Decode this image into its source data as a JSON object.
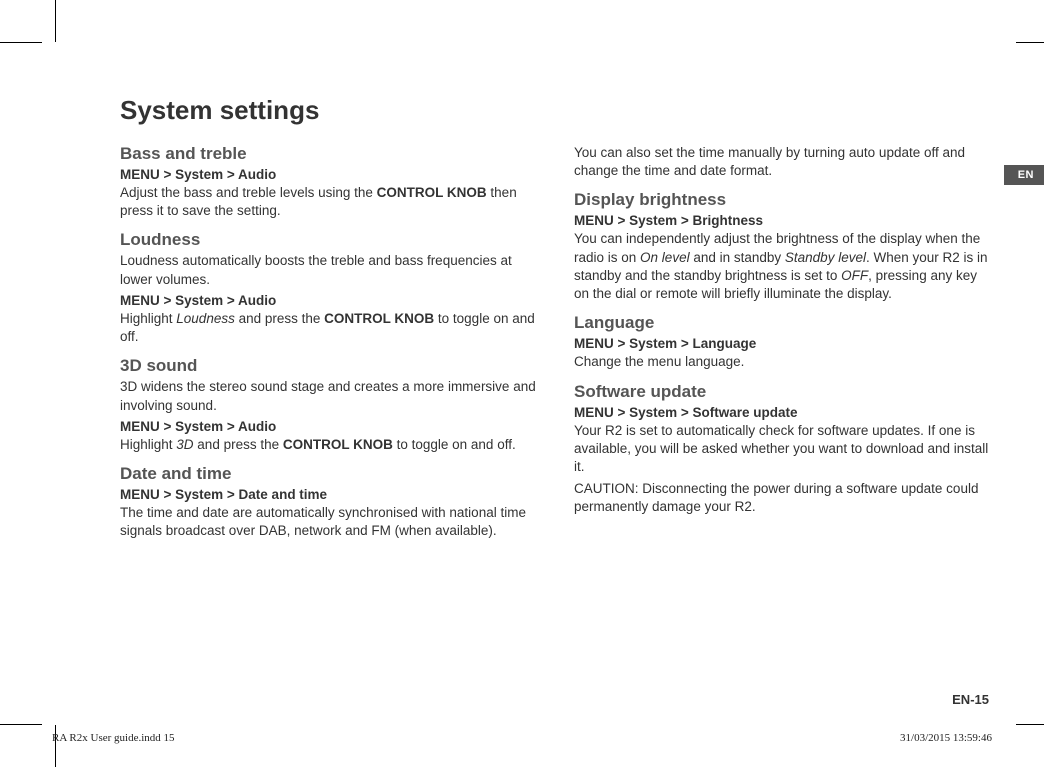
{
  "title": "System settings",
  "langTab": "EN",
  "pageNumber": "EN-15",
  "footer": {
    "left": "RA R2x User guide.indd   15",
    "right": "31/03/2015   13:59:46"
  },
  "left": {
    "bass": {
      "heading": "Bass and treble",
      "path": "MENU > System > Audio",
      "p1a": "Adjust the bass and treble levels using the ",
      "p1b": "CONTROL KNOB",
      "p1c": " then press it to save the setting."
    },
    "loudness": {
      "heading": "Loudness",
      "p1": "Loudness automatically boosts the treble and bass frequencies at lower volumes.",
      "path": "MENU > System > Audio",
      "p2a": "Highlight ",
      "p2b": "Loudness",
      "p2c": " and press the ",
      "p2d": "CONTROL KNOB",
      "p2e": " to toggle on and off."
    },
    "sound3d": {
      "heading": "3D sound",
      "p1": "3D widens the stereo sound stage and creates a more immersive and involving sound.",
      "path": "MENU > System > Audio",
      "p2a": "Highlight ",
      "p2b": "3D",
      "p2c": " and press the ",
      "p2d": "CONTROL KNOB",
      "p2e": " to toggle on and off."
    },
    "datetime": {
      "heading": "Date and time",
      "path": "MENU > System > Date and time",
      "p1": "The time and date are automatically synchronised with national time signals broadcast over DAB, network and FM (when available)."
    }
  },
  "right": {
    "intro": "You can also set the time manually by turning auto update off and change the time and date format.",
    "display": {
      "heading": "Display brightness",
      "path": "MENU > System > Brightness",
      "p1a": "You can independently adjust the brightness of the display when the radio is on ",
      "p1b": "On level",
      "p1c": " and in standby ",
      "p1d": "Standby level",
      "p1e": ". When your R2 is in standby and the standby brightness is set to ",
      "p1f": "OFF",
      "p1g": ", pressing any key on the dial or remote will briefly illuminate the display."
    },
    "language": {
      "heading": "Language",
      "path": "MENU > System > Language",
      "p1": "Change the menu language."
    },
    "software": {
      "heading": "Software update",
      "path": "MENU > System > Software update",
      "p1": "Your R2 is set to automatically check for software updates. If one is available, you will be asked whether you want to download and install it.",
      "p2": "CAUTION: Disconnecting the power during a software update could permanently damage your R2."
    }
  }
}
